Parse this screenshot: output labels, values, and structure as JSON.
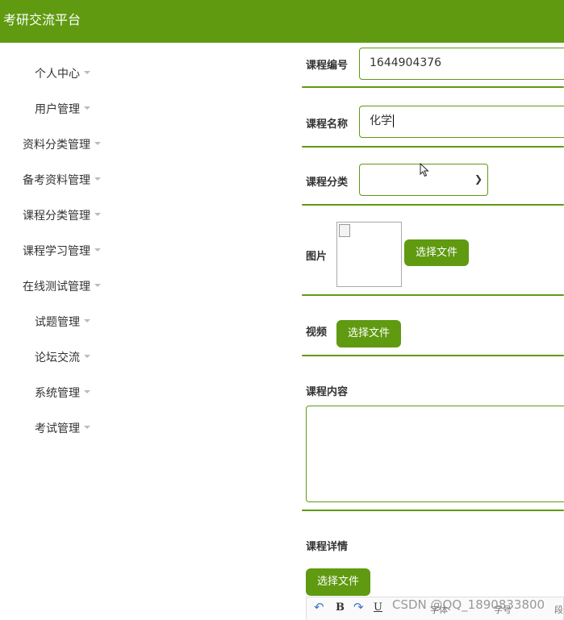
{
  "app": {
    "title": "考研交流平台"
  },
  "sidebar": {
    "items": [
      {
        "label": "个人中心"
      },
      {
        "label": "用户管理"
      },
      {
        "label": "资料分类管理"
      },
      {
        "label": "备考资料管理"
      },
      {
        "label": "课程分类管理"
      },
      {
        "label": "课程学习管理"
      },
      {
        "label": "在线测试管理"
      },
      {
        "label": "试题管理"
      },
      {
        "label": "论坛交流"
      },
      {
        "label": "系统管理"
      },
      {
        "label": "考试管理"
      }
    ]
  },
  "form": {
    "course_id": {
      "label": "课程编号",
      "value": "1644904376"
    },
    "course_name": {
      "label": "课程名称",
      "value": "化学"
    },
    "course_category": {
      "label": "课程分类",
      "value": ""
    },
    "image": {
      "label": "图片",
      "button": "选择文件"
    },
    "video": {
      "label": "视频",
      "button": "选择文件"
    },
    "content": {
      "label": "课程内容"
    },
    "details": {
      "label": "课程详情",
      "button": "选择文件"
    }
  },
  "editor_toolbar": {
    "bold": "B",
    "underline": "U",
    "font_family": "字体",
    "font_size": "字号",
    "paragraph": "段"
  },
  "watermark": "CSDN @QQ_1890833800",
  "colors": {
    "primary": "#5f9a10"
  }
}
